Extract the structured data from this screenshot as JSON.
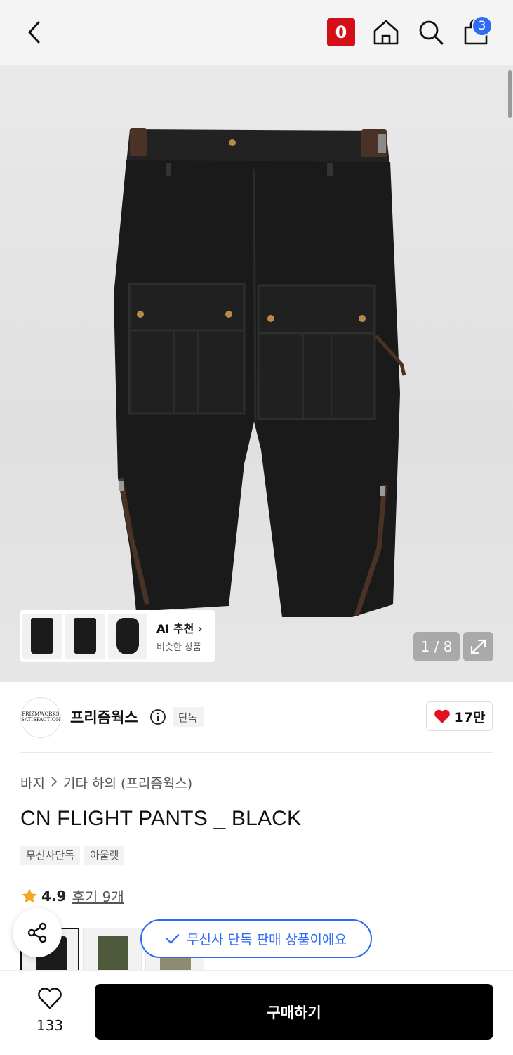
{
  "header": {
    "icons": [
      "back-icon",
      "musinsa-logo",
      "home-icon",
      "search-icon",
      "bag-icon"
    ],
    "logo_letter": "0",
    "cart_count": "3"
  },
  "gallery": {
    "ai_title": "AI 추천 ›",
    "ai_subtitle": "비슷한 상품",
    "counter": "1 / 8"
  },
  "brand": {
    "logo_text": "FRIZMWORKS SATISFACTION",
    "name": "프리즘웍스",
    "exclusive": "단독",
    "likes": "17만"
  },
  "breadcrumb": {
    "category": "바지",
    "subcategory": "기타 하의 (프리즘웍스)"
  },
  "product": {
    "title": "CN FLIGHT PANTS _ BLACK",
    "tags": [
      "무신사단독",
      "아울렛"
    ],
    "rating": "4.9",
    "review_label": "후기 9개"
  },
  "toast": {
    "text": "무신사 단독 판매 상품이에요"
  },
  "bottom": {
    "wish_count": "133",
    "buy_label": "구매하기"
  },
  "colors": {
    "accent_red": "#d50f17",
    "accent_blue": "#2f6cf6",
    "heart_red": "#e0131e"
  }
}
